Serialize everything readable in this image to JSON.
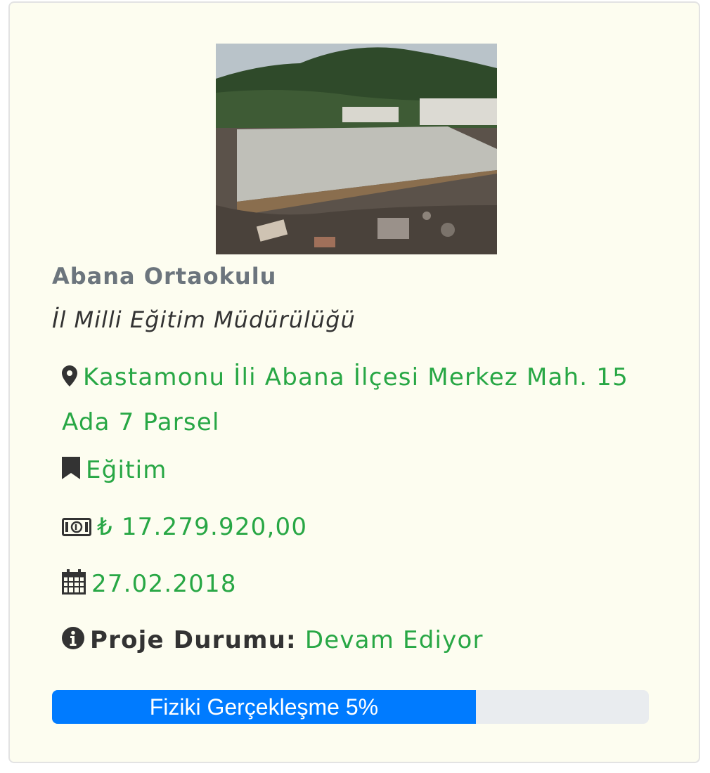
{
  "project": {
    "name": "Abana Ortaokulu",
    "institution": "İl Milli Eğitim Müdürülüğü",
    "address": "Kastamonu İli Abana İlçesi Merkez Mah. 15 Ada 7 Parsel",
    "category": "Eğitim",
    "cost": "₺ 17.279.920,00",
    "date": "27.02.2018",
    "status_label": "Proje Durumu:",
    "status_value": "Devam Ediyor",
    "progress_label": "Fiziki Gerçekleşme 5%",
    "progress_percent": 5
  },
  "icons": {
    "address": "map-marker-icon",
    "category": "bookmark-icon",
    "cost": "money-bill-icon",
    "date": "calendar-icon",
    "status": "info-circle-icon"
  },
  "colors": {
    "card_background": "#fdfdf0",
    "title": "#6c757d",
    "accent": "#28a745",
    "progress_fill": "#007bff",
    "progress_track": "#e9ecef"
  }
}
